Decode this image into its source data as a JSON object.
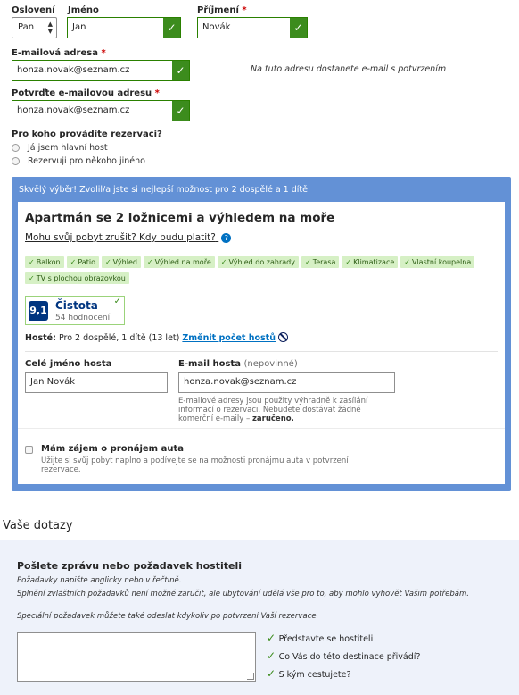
{
  "form": {
    "salutation": {
      "label": "Oslovení",
      "value": "Pan"
    },
    "first_name": {
      "label": "Jméno",
      "value": "Jan"
    },
    "last_name": {
      "label": "Příjmení",
      "required": "*",
      "value": "Novák"
    },
    "email": {
      "label": "E-mailová adresa",
      "required": "*",
      "value": "honza.novak@seznam.cz",
      "hint": "Na tuto adresu dostanete e-mail s potvrzením"
    },
    "email_confirm": {
      "label": "Potvrďte e-mailovou adresu",
      "required": "*",
      "value": "honza.novak@seznam.cz"
    },
    "for_whom": {
      "question": "Pro koho provádíte rezervaci?",
      "options": [
        "Já jsem hlavní host",
        "Rezervuji pro někoho jiného"
      ]
    }
  },
  "room_panel": {
    "header": "Skvělý výběr! Zvolil/a jste si nejlepší možnost pro 2 dospělé a 1 dítě.",
    "room_title": "Apartmán se 2 ložnicemi a výhledem na moře",
    "policy_link": "Mohu svůj pobyt zrušit? Kdy budu platit?",
    "amenities": [
      "Balkon",
      "Patio",
      "Výhled",
      "Výhled na moře",
      "Výhled do zahrady",
      "Terasa",
      "Klimatizace",
      "Vlastní koupelna",
      "TV s plochou obrazovkou"
    ],
    "score": {
      "value": "9,1",
      "label": "Čistota",
      "reviews": "54 hodnocení"
    },
    "guests": {
      "label": "Hosté:",
      "value": "Pro 2 dospělé, 1 dítě (13 let)",
      "change_link": "Změnit počet hostů"
    },
    "guest_name": {
      "label": "Celé jméno hosta",
      "value": "Jan  Novák"
    },
    "guest_email": {
      "label": "E-mail hosta",
      "optional": "(nepovinné)",
      "value": "honza.novak@seznam.cz",
      "note": "E-mailové adresy jsou použity výhradně k zasílání informací o rezervaci. Nebudete dostávat žádné komerční e-maily –",
      "note_bold": "zaručeno."
    },
    "car_rental": {
      "label": "Mám zájem o pronájem auta",
      "desc": "Užijte si svůj pobyt naplno a podívejte se na možnosti pronájmu auta v potvrzení rezervace."
    }
  },
  "questions": {
    "section_title": "Vaše dotazy",
    "box_title": "Pošlete zprávu nebo požadavek hostiteli",
    "lines": [
      "Požadavky napište anglicky nebo v řečtině.",
      "Splnění zvláštních požadavků není možné zaručit, ale ubytování udělá vše pro to, aby mohlo vyhovět Vašim potřebám.",
      "Speciální požadavek můžete také odeslat kdykoliv po potvrzení Vaší rezervace."
    ],
    "tips": [
      "Představte se hostiteli",
      "Co Vás do této destinace přivádí?",
      "S kým cestujete?"
    ]
  },
  "colors": {
    "accent_green": "#3c8c1d",
    "panel_blue": "#6391d6",
    "link_blue": "#0071c2",
    "score_blue": "#003580"
  }
}
